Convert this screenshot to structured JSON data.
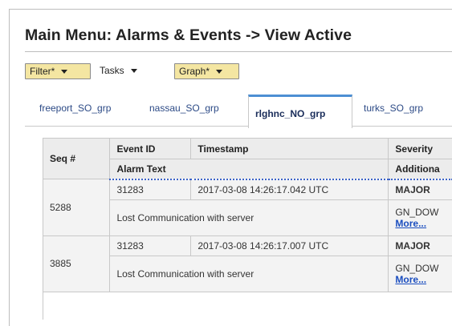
{
  "page": {
    "title": "Main Menu: Alarms & Events -> View Active"
  },
  "toolbar": {
    "filter_label": "Filter*",
    "tasks_label": "Tasks",
    "graph_label": "Graph*"
  },
  "tabs": [
    {
      "label": "freeport_SO_grp"
    },
    {
      "label": "nassau_SO_grp"
    },
    {
      "label": "rlghnc_NO_grp"
    },
    {
      "label": "turks_SO_grp"
    }
  ],
  "grid": {
    "headers": {
      "seq": "Seq #",
      "event_id": "Event ID",
      "timestamp": "Timestamp",
      "severity": "Severity",
      "alarm_text": "Alarm Text",
      "additional": "Additiona"
    },
    "rows": [
      {
        "seq": "5288",
        "event_id": "31283",
        "timestamp": "2017-03-08 14:26:17.042 UTC",
        "severity": "MAJOR",
        "alarm_text": "Lost Communication with server",
        "additional": "GN_DOW",
        "more": "More..."
      },
      {
        "seq": "3885",
        "event_id": "31283",
        "timestamp": "2017-03-08 14:26:17.007 UTC",
        "severity": "MAJOR",
        "alarm_text": "Lost Communication with server",
        "additional": "GN_DOW",
        "more": "More..."
      }
    ]
  }
}
